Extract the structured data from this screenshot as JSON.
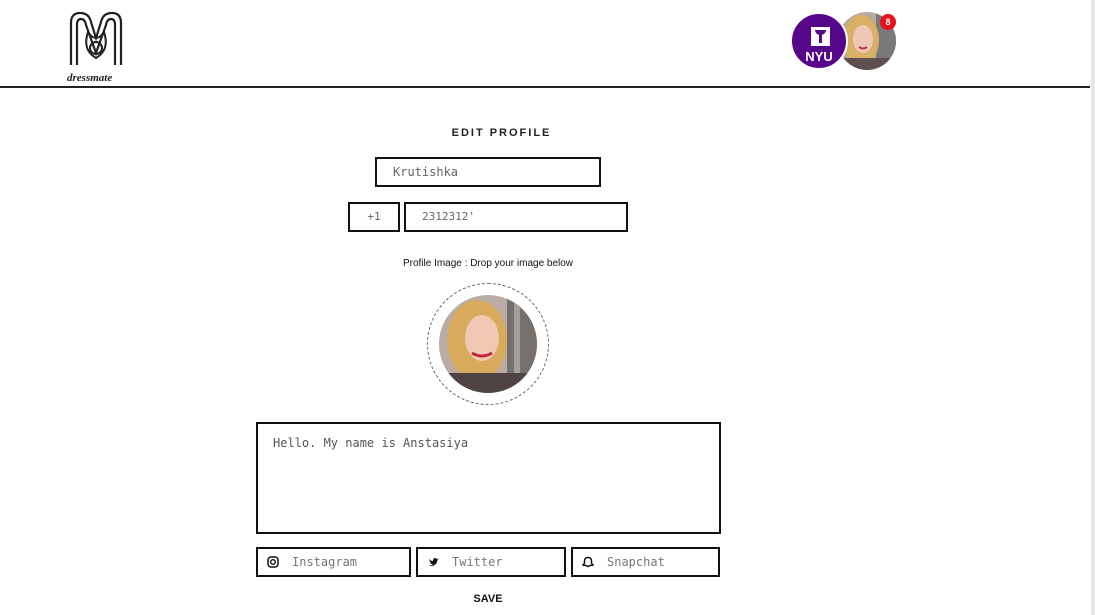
{
  "header": {
    "logo_text": "dressmate",
    "nyu_label": "NYU",
    "notification_count": "8"
  },
  "form": {
    "title": "EDIT PROFILE",
    "name_value": "Krutishka",
    "country_code": "+1",
    "phone_value": "2312312'",
    "image_label": "Profile Image : Drop your image below",
    "bio_value": "Hello. My name is Anstasiya",
    "social": {
      "instagram_placeholder": "Instagram",
      "twitter_placeholder": "Twitter",
      "snapchat_placeholder": "Snapchat"
    },
    "save_label": "SAVE"
  },
  "icons": {
    "logo": "dressmate-logo-icon",
    "instagram": "instagram-icon",
    "twitter": "twitter-icon",
    "snapchat": "snapchat-icon"
  },
  "colors": {
    "nyu_purple": "#57068c",
    "notification_red": "#e8121f",
    "border": "#111111"
  }
}
